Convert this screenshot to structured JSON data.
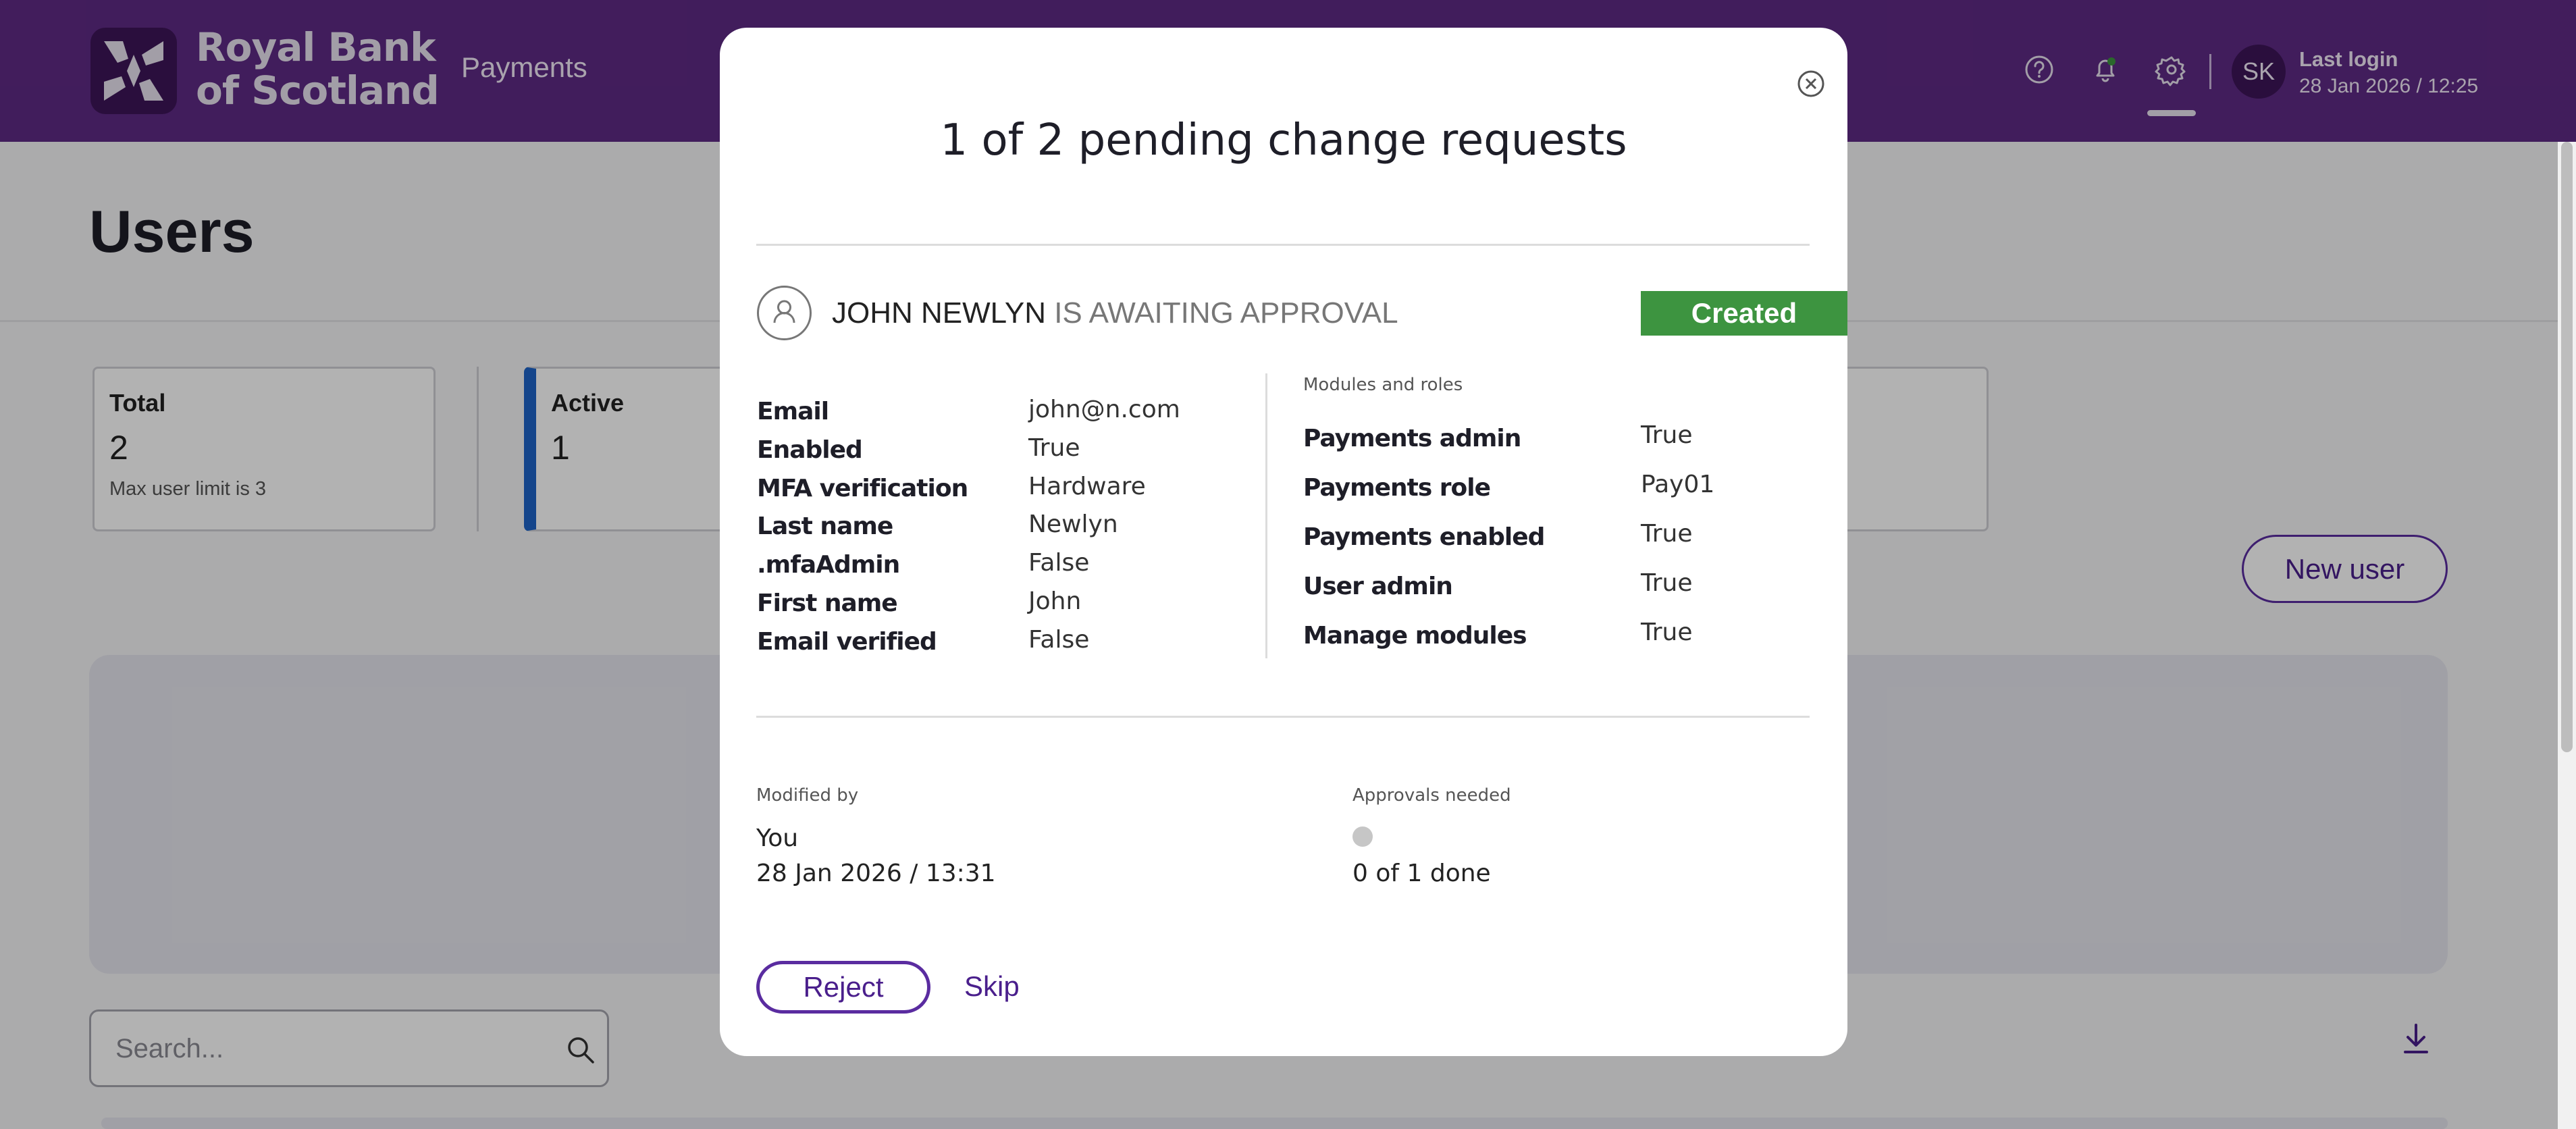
{
  "header": {
    "brand_line1": "Royal Bank",
    "brand_line2": "of Scotland",
    "nav_payments": "Payments",
    "avatar_initials": "SK",
    "last_login_label": "Last login",
    "last_login_value": "28 Jan 2026 / 12:25",
    "icons": [
      "help-icon",
      "bell-icon",
      "gear-icon"
    ],
    "notification_dot_color": "#3d9440",
    "brand_color": "#5e2a84"
  },
  "page": {
    "title": "Users",
    "stats": [
      {
        "label": "Total",
        "value": "2",
        "sub": "Max user limit is 3"
      },
      {
        "label": "Active",
        "value": "1"
      }
    ],
    "new_user_label": "New user",
    "search_placeholder": "Search..."
  },
  "modal": {
    "title": "1 of 2 pending change requests",
    "user_name": "JOHN NEWLYN",
    "status_text": " IS AWAITING APPROVAL",
    "badge": "Created",
    "badge_color": "#3d9440",
    "fields": [
      {
        "label": "Email",
        "value": "john@n.com"
      },
      {
        "label": "Enabled",
        "value": "True"
      },
      {
        "label": "MFA verification",
        "value": "Hardware"
      },
      {
        "label": "Last name",
        "value": "Newlyn"
      },
      {
        "label": ".mfaAdmin",
        "value": "False"
      },
      {
        "label": "First name",
        "value": "John"
      },
      {
        "label": "Email verified",
        "value": "False"
      }
    ],
    "modules_heading": "Modules and roles",
    "modules": [
      {
        "label": "Payments admin",
        "value": "True"
      },
      {
        "label": "Payments role",
        "value": "Pay01"
      },
      {
        "label": "Payments enabled",
        "value": "True"
      },
      {
        "label": "User admin",
        "value": "True"
      },
      {
        "label": "Manage modules",
        "value": "True"
      }
    ],
    "modified_by_label": "Modified by",
    "modified_by": "You",
    "modified_at": "28 Jan 2026 / 13:31",
    "approvals_label": "Approvals needed",
    "approvals_status": "0 of 1 done",
    "reject_label": "Reject",
    "skip_label": "Skip"
  }
}
